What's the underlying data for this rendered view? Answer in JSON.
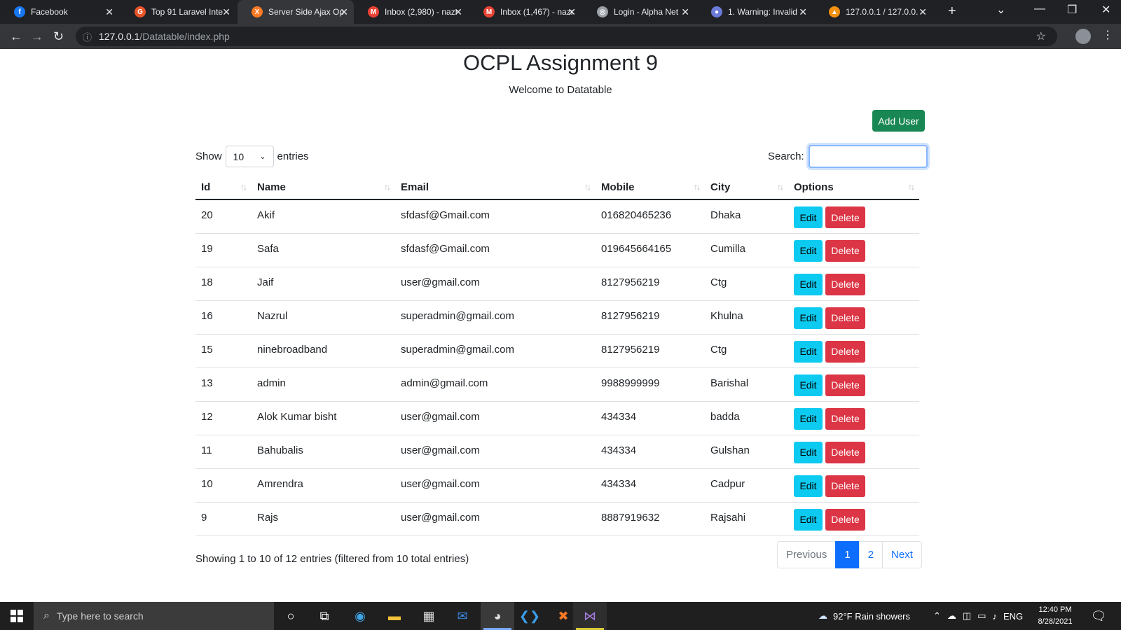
{
  "browser": {
    "tabs": [
      {
        "title": "Facebook",
        "icon": "facebook-icon",
        "color": "#1877f2",
        "glyph": "f"
      },
      {
        "title": "Top 91 Laravel Inte",
        "icon": "site-icon",
        "color": "#e8542a",
        "glyph": "G"
      },
      {
        "title": "Server Side Ajax Op",
        "icon": "xampp-icon",
        "color": "#fb7a24",
        "glyph": "X"
      },
      {
        "title": "Inbox (2,980) - nazr",
        "icon": "gmail-icon",
        "color": "#ea4335",
        "glyph": "M"
      },
      {
        "title": "Inbox (1,467) - nazr",
        "icon": "gmail-icon",
        "color": "#ea4335",
        "glyph": "M"
      },
      {
        "title": "Login - Alpha Net",
        "icon": "globe-icon",
        "color": "#9aa0a6",
        "glyph": "◎"
      },
      {
        "title": "1. Warning: Invalid",
        "icon": "site-icon",
        "color": "#6c7bd8",
        "glyph": "●"
      },
      {
        "title": "127.0.0.1 / 127.0.0.",
        "icon": "phpmyadmin-icon",
        "color": "#f29111",
        "glyph": "▲"
      }
    ],
    "url_host": "127.0.0.1",
    "url_path": "/Datatable/index.php"
  },
  "page": {
    "title": "OCPL Assignment 9",
    "subtitle": "Welcome to Datatable",
    "add_user_label": "Add User",
    "show_label": "Show",
    "entries_label": "entries",
    "length_value": "10",
    "search_label": "Search:",
    "search_value": ""
  },
  "table": {
    "headers": [
      "Id",
      "Name",
      "Email",
      "Mobile",
      "City",
      "Options"
    ],
    "edit_label": "Edit",
    "delete_label": "Delete",
    "rows": [
      [
        "20",
        "Akif",
        "sfdasf@Gmail.com",
        "016820465236",
        "Dhaka"
      ],
      [
        "19",
        "Safa",
        "sfdasf@Gmail.com",
        "019645664165",
        "Cumilla"
      ],
      [
        "18",
        "Jaif",
        "user@gmail.com",
        "8127956219",
        "Ctg"
      ],
      [
        "16",
        "Nazrul",
        "superadmin@gmail.com",
        "8127956219",
        "Khulna"
      ],
      [
        "15",
        "ninebroadband",
        "superadmin@gmail.com",
        "8127956219",
        "Ctg"
      ],
      [
        "13",
        "admin",
        "admin@gmail.com",
        "9988999999",
        "Barishal"
      ],
      [
        "12",
        "Alok Kumar bisht",
        "user@gmail.com",
        "434334",
        "badda"
      ],
      [
        "11",
        "Bahubalis",
        "user@gmail.com",
        "434334",
        "Gulshan"
      ],
      [
        "10",
        "Amrendra",
        "user@gmail.com",
        "434334",
        "Cadpur"
      ],
      [
        "9",
        "Rajs",
        "user@gmail.com",
        "8887919632",
        "Rajsahi"
      ]
    ]
  },
  "footer": {
    "info": "Showing 1 to 10 of 12 entries (filtered from 10 total entries)",
    "previous": "Previous",
    "pages": [
      "1",
      "2"
    ],
    "next": "Next"
  },
  "taskbar": {
    "search_placeholder": "Type here to search",
    "weather": "92°F  Rain showers",
    "lang": "ENG",
    "time": "12:40 PM",
    "date": "8/28/2021"
  }
}
